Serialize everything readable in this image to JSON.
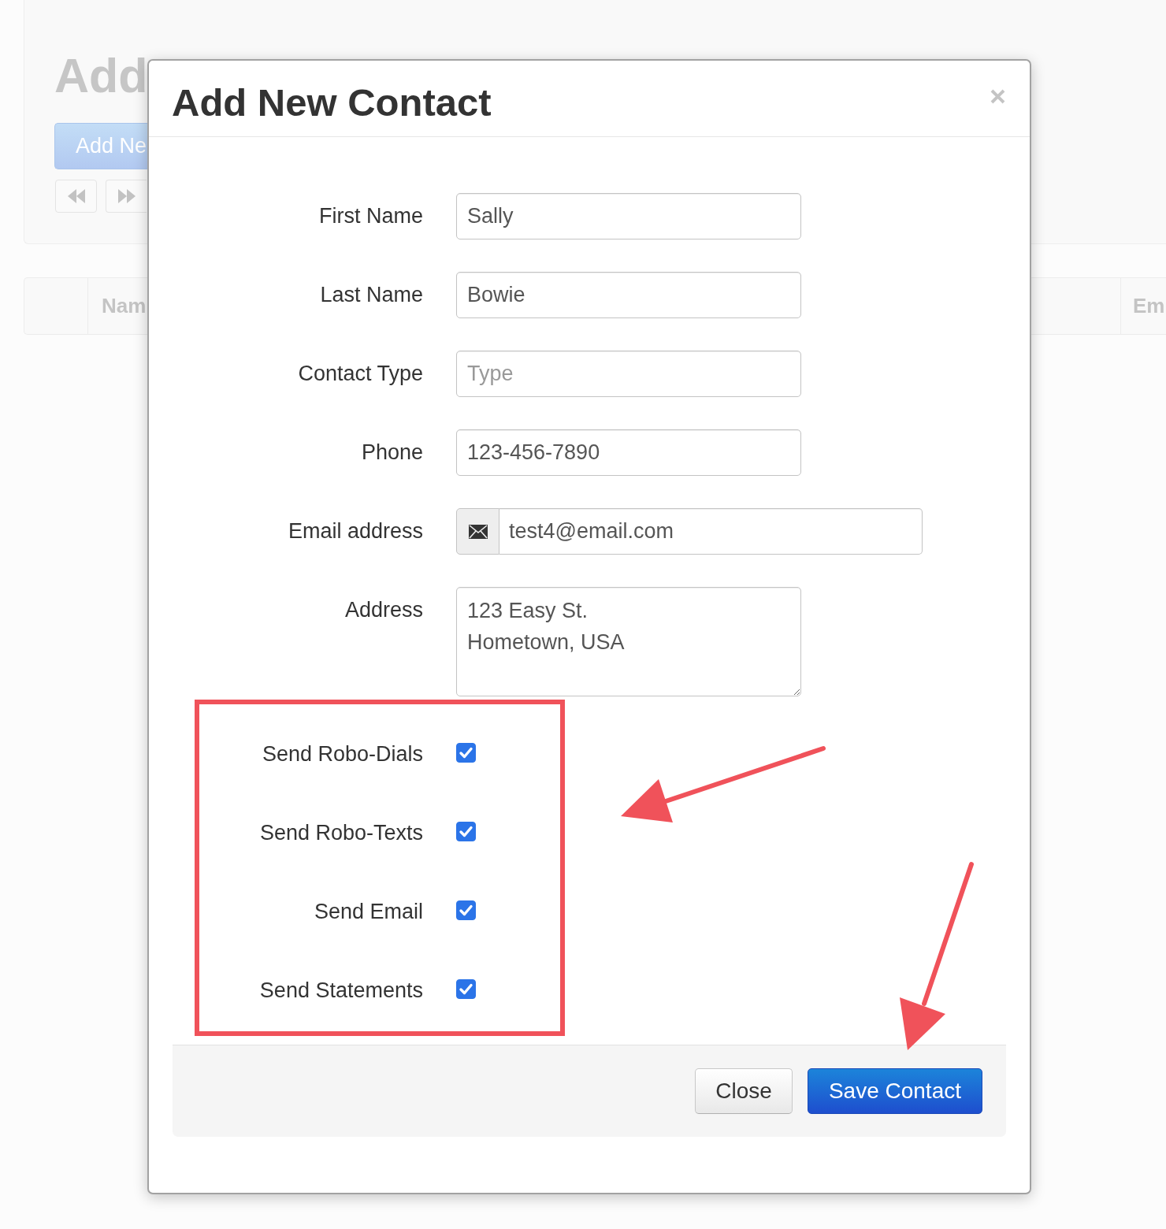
{
  "background": {
    "heading": "Add",
    "add_button": "Add Ne",
    "table": {
      "columns": [
        {
          "label": "Nam"
        },
        {
          "label": "Em"
        }
      ]
    }
  },
  "dialog": {
    "title": "Add New Contact",
    "fields": [
      {
        "kind": "text",
        "label": "First Name",
        "value": "Sally"
      },
      {
        "kind": "text",
        "label": "Last Name",
        "value": "Bowie"
      },
      {
        "kind": "text",
        "label": "Contact Type",
        "placeholder": "Type"
      },
      {
        "kind": "text",
        "label": "Phone",
        "value": "123-456-7890"
      },
      {
        "kind": "email",
        "label": "Email address",
        "value": "test4@email.com"
      },
      {
        "kind": "textarea",
        "label": "Address",
        "value": "123 Easy St.\nHometown, USA"
      }
    ],
    "options": [
      {
        "label": "Send Robo-Dials",
        "checked": true
      },
      {
        "label": "Send Robo-Texts",
        "checked": true
      },
      {
        "label": "Send Email",
        "checked": true
      },
      {
        "label": "Send Statements",
        "checked": true
      }
    ],
    "buttons": [
      {
        "label": "Close",
        "kind": "dismiss"
      },
      {
        "label": "Save Contact",
        "kind": "save"
      }
    ]
  }
}
